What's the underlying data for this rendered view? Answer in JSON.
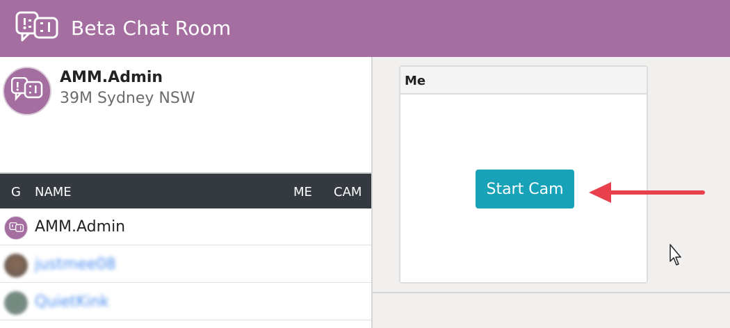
{
  "app": {
    "title": "Beta Chat Room"
  },
  "profile": {
    "name": "AMM.Admin",
    "subtitle": "39M Sydney NSW"
  },
  "user_list": {
    "columns": {
      "g": "G",
      "name": "NAME",
      "me": "ME",
      "cam": "CAM"
    },
    "rows": [
      {
        "name": "AMM.Admin",
        "avatar": "app-logo-avatar"
      },
      {
        "name": "justmee08",
        "avatar": "photo-avatar"
      },
      {
        "name": "QuietKink",
        "avatar": "photo-avatar"
      }
    ]
  },
  "camera_panel": {
    "title": "Me",
    "start_button": "Start Cam"
  },
  "colors": {
    "brand": "#a56ea0",
    "header_dark": "#343a40",
    "button": "#17a2b8",
    "arrow": "#e8414b"
  }
}
